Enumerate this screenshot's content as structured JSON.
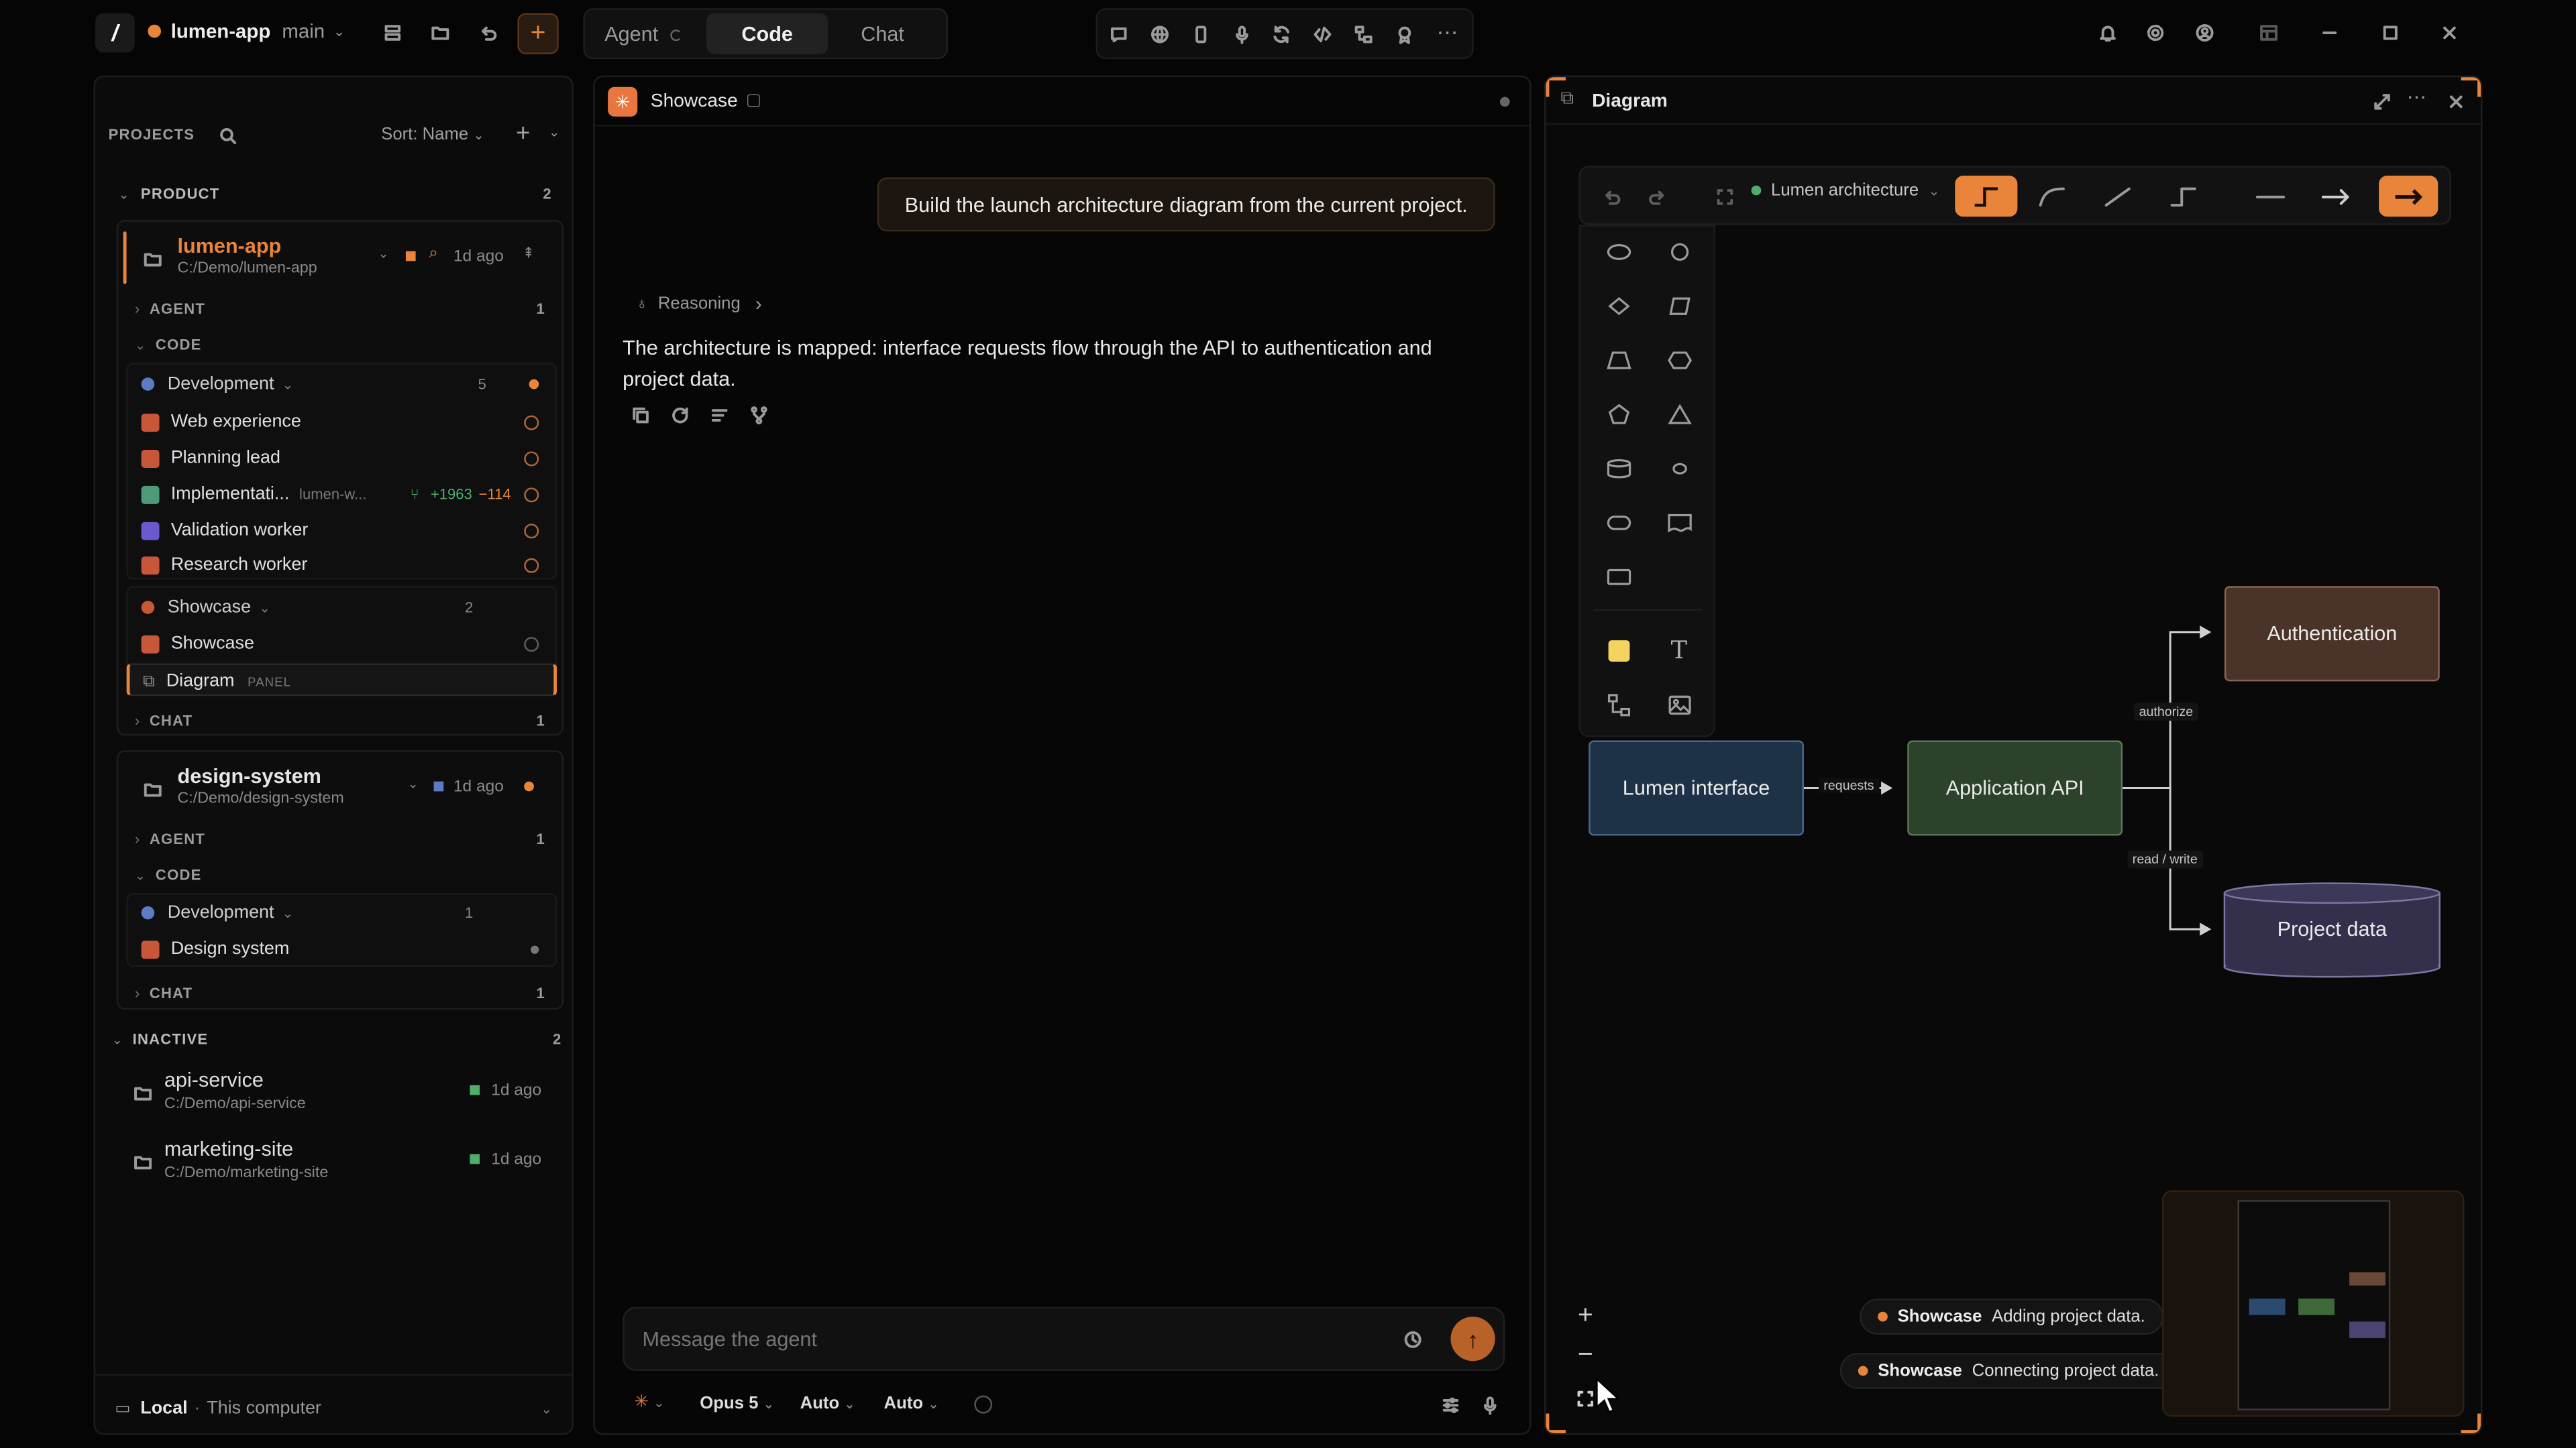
{
  "titlebar": {
    "project": "lumen-app",
    "branch": "main",
    "modes": [
      "Agent",
      "Code",
      "Chat"
    ],
    "active_mode": "Code"
  },
  "sidebar": {
    "header": "PROJECTS",
    "sort": "Sort: Name",
    "groups": {
      "product": {
        "label": "PRODUCT",
        "count": "2"
      },
      "inactive": {
        "label": "INACTIVE",
        "count": "2"
      }
    },
    "lumen": {
      "name": "lumen-app",
      "path": "C:/Demo/lumen-app",
      "age": "1d ago",
      "agent": {
        "label": "AGENT",
        "count": "1"
      },
      "code": {
        "label": "CODE"
      },
      "chat": {
        "label": "CHAT",
        "count": "1"
      },
      "dev": {
        "label": "Development",
        "count": "5"
      },
      "items": [
        {
          "label": "Web experience"
        },
        {
          "label": "Planning lead"
        },
        {
          "label": "Implementati...",
          "sub": "lumen-w...",
          "add": "+1963",
          "del": "−114"
        },
        {
          "label": "Validation worker"
        },
        {
          "label": "Research worker"
        }
      ],
      "showcase_group": {
        "label": "Showcase",
        "count": "2"
      },
      "showcase_item": "Showcase",
      "diagram_item": {
        "label": "Diagram",
        "badge": "PANEL"
      }
    },
    "design": {
      "name": "design-system",
      "path": "C:/Demo/design-system",
      "age": "1d ago",
      "agent": {
        "label": "AGENT",
        "count": "1"
      },
      "code": {
        "label": "CODE"
      },
      "dev": {
        "label": "Development",
        "count": "1"
      },
      "item": "Design system",
      "chat": {
        "label": "CHAT",
        "count": "1"
      }
    },
    "inactive": [
      {
        "name": "api-service",
        "path": "C:/Demo/api-service",
        "age": "1d ago"
      },
      {
        "name": "marketing-site",
        "path": "C:/Demo/marketing-site",
        "age": "1d ago"
      }
    ],
    "footer": {
      "label": "Local",
      "sep": "·",
      "sub": "This computer"
    }
  },
  "chat": {
    "tab": "Showcase",
    "user_message": "Build the launch architecture diagram from the current project.",
    "reasoning": "Reasoning",
    "reply": "The architecture is mapped: interface requests flow through the API to authentication and project data.",
    "input_placeholder": "Message the agent",
    "model": "Opus 5",
    "opt1": "Auto",
    "opt2": "Auto"
  },
  "diagram": {
    "title": "Diagram",
    "doc_name": "Lumen architecture",
    "nodes": {
      "interface": "Lumen interface",
      "api": "Application API",
      "auth": "Authentication",
      "data": "Project data"
    },
    "edges": {
      "requests": "requests",
      "authorize": "authorize",
      "readwrite": "read / write"
    },
    "toasts": [
      {
        "tag": "Showcase",
        "text": "Adding project data."
      },
      {
        "tag": "Showcase",
        "text": "Connecting project data."
      }
    ]
  },
  "colors": {
    "accent": "#e8853a",
    "interface": "#1d3147",
    "api": "#2c422a",
    "auth": "#4a3328",
    "data": "#34304c"
  }
}
